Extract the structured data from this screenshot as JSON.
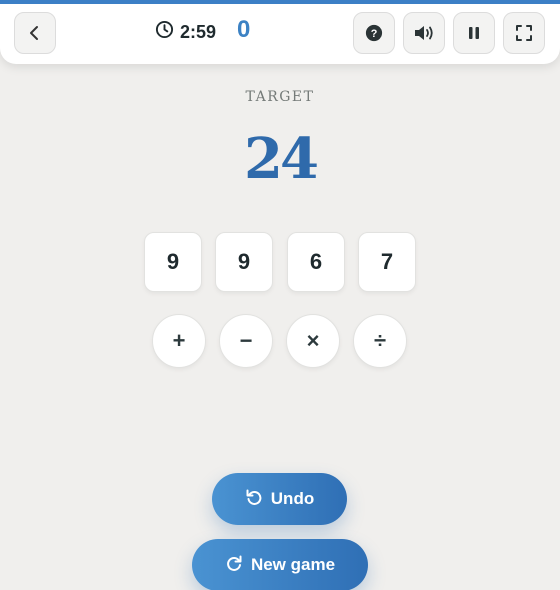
{
  "header": {
    "timer": "2:59",
    "score": "0",
    "icons": {
      "back": "chevron-left-icon",
      "clock": "clock-icon",
      "help": "help-icon",
      "sound": "volume-icon",
      "pause": "pause-icon",
      "fullscreen": "fullscreen-icon"
    }
  },
  "target": {
    "label": "TARGET",
    "value": "24"
  },
  "numbers": [
    "9",
    "9",
    "6",
    "7"
  ],
  "operators": [
    "+",
    "−",
    "×",
    "÷"
  ],
  "actions": {
    "undo_label": "Undo",
    "new_game_label": "New game"
  },
  "colors": {
    "accent": "#3c7fc6",
    "target": "#2f6aab",
    "score": "#3c82c4",
    "background": "#f0efed"
  }
}
